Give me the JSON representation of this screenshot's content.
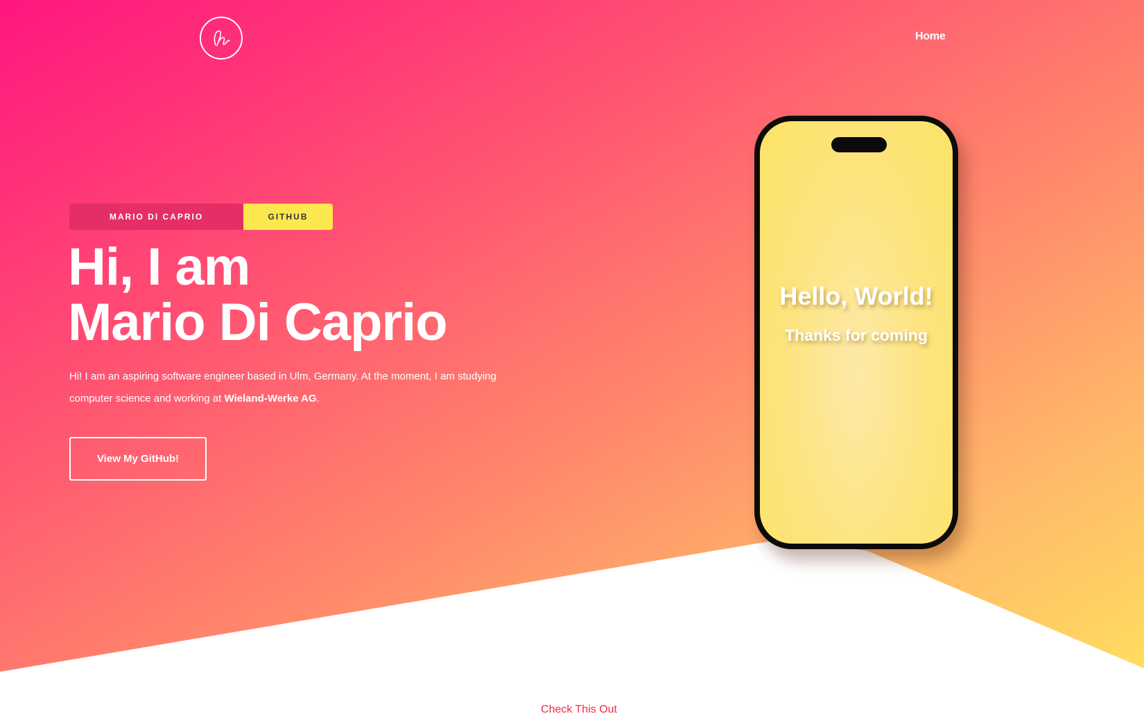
{
  "header": {
    "logo_icon": "signature-logo-icon",
    "nav": {
      "home_label": "Home"
    }
  },
  "hero": {
    "badges": {
      "name": "MARIO DI CAPRIO",
      "github": "GITHUB"
    },
    "headline_line1": "Hi, I am",
    "headline_line2": "Mario Di Caprio",
    "intro_before": "Hi! I am an aspiring software engineer based in Ulm, Germany. At the moment, I am studying computer science and working at ",
    "intro_company": "Wieland-Werke AG",
    "intro_after": ".",
    "cta_label": "View My GitHub!"
  },
  "phone": {
    "title": "Hello, World!",
    "subtitle": "Thanks for coming"
  },
  "next_section": {
    "label": "Check This Out"
  },
  "colors": {
    "gradient_start": "#ff167f",
    "gradient_end": "#ffe35d",
    "badge_name_bg": "#e52e66",
    "badge_github_bg": "#fce74e",
    "phone_screen": "#fce468",
    "link_red": "#ef2b45"
  }
}
